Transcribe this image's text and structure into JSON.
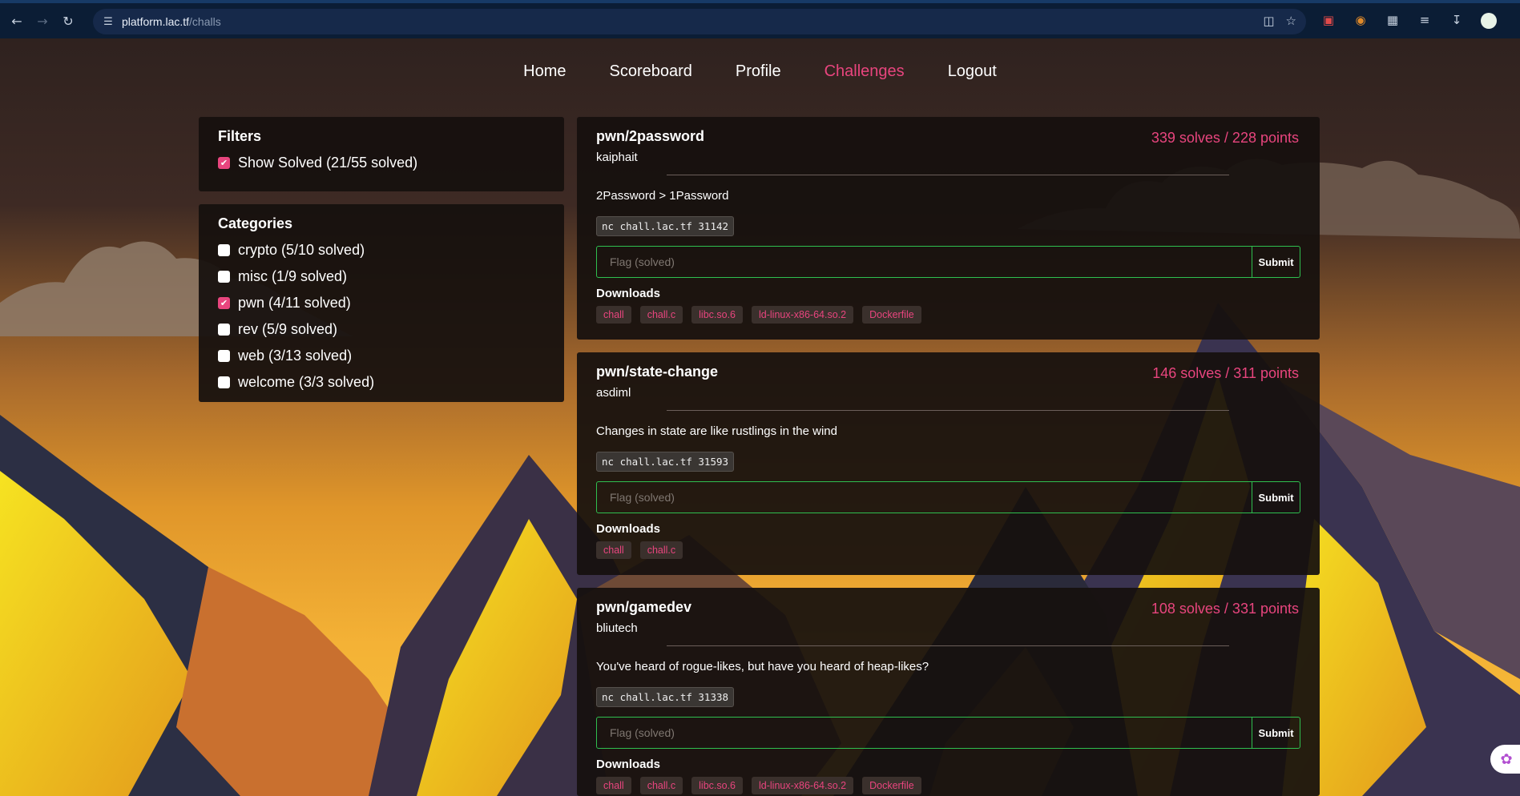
{
  "browser": {
    "url_host": "platform.lac.tf",
    "url_path": "/challs"
  },
  "nav": {
    "items": [
      "Home",
      "Scoreboard",
      "Profile",
      "Challenges",
      "Logout"
    ],
    "active": "Challenges"
  },
  "filters": {
    "title": "Filters",
    "show_solved": {
      "label": "Show Solved (21/55 solved)",
      "checked": true
    }
  },
  "categories": {
    "title": "Categories",
    "items": [
      {
        "label": "crypto (5/10 solved)",
        "checked": false
      },
      {
        "label": "misc (1/9 solved)",
        "checked": false
      },
      {
        "label": "pwn (4/11 solved)",
        "checked": true
      },
      {
        "label": "rev (5/9 solved)",
        "checked": false
      },
      {
        "label": "web (3/13 solved)",
        "checked": false
      },
      {
        "label": "welcome (3/3 solved)",
        "checked": false
      }
    ]
  },
  "challenges": [
    {
      "title": "pwn/2password",
      "author": "kaiphait",
      "score": "339 solves / 228 points",
      "description": "2Password > 1Password",
      "command": "nc chall.lac.tf 31142",
      "flag_placeholder": "Flag (solved)",
      "submit": "Submit",
      "downloads_title": "Downloads",
      "downloads": [
        "chall",
        "chall.c",
        "libc.so.6",
        "ld-linux-x86-64.so.2",
        "Dockerfile"
      ]
    },
    {
      "title": "pwn/state-change",
      "author": "asdiml",
      "score": "146 solves / 311 points",
      "description": "Changes in state are like rustlings in the wind",
      "command": "nc chall.lac.tf 31593",
      "flag_placeholder": "Flag (solved)",
      "submit": "Submit",
      "downloads_title": "Downloads",
      "downloads": [
        "chall",
        "chall.c"
      ]
    },
    {
      "title": "pwn/gamedev",
      "author": "bliutech",
      "score": "108 solves / 331 points",
      "description": "You've heard of rogue-likes, but have you heard of heap-likes?",
      "command": "nc chall.lac.tf 31338",
      "flag_placeholder": "Flag (solved)",
      "submit": "Submit",
      "downloads_title": "Downloads",
      "downloads": [
        "chall",
        "chall.c",
        "libc.so.6",
        "ld-linux-x86-64.so.2",
        "Dockerfile"
      ]
    }
  ]
}
